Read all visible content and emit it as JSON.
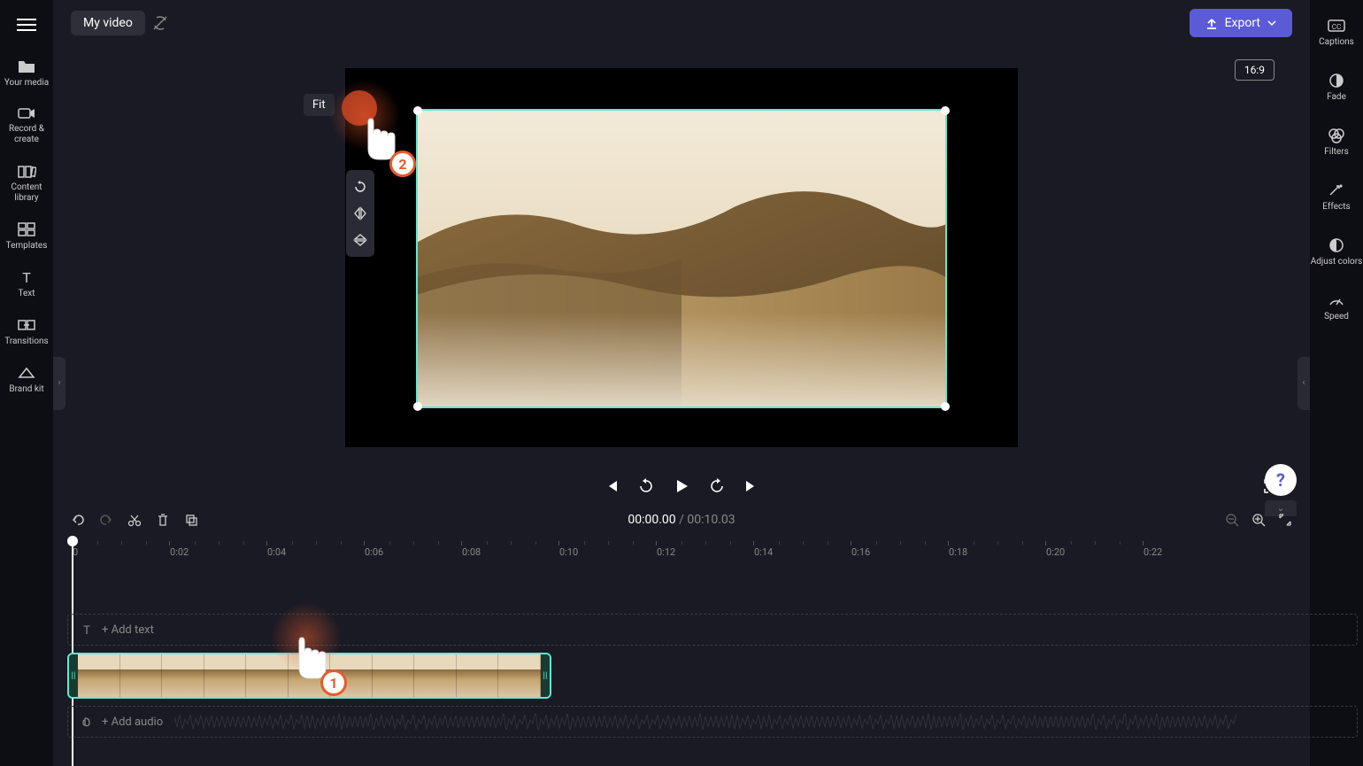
{
  "top": {
    "video_title": "My video",
    "export_label": "Export",
    "aspect_ratio": "16:9"
  },
  "left_sidebar": [
    {
      "key": "your-media",
      "label": "Your media"
    },
    {
      "key": "record-create",
      "label": "Record & create"
    },
    {
      "key": "content-library",
      "label": "Content library"
    },
    {
      "key": "templates",
      "label": "Templates"
    },
    {
      "key": "text",
      "label": "Text"
    },
    {
      "key": "transitions",
      "label": "Transitions"
    },
    {
      "key": "brand-kit",
      "label": "Brand kit"
    }
  ],
  "right_sidebar": [
    {
      "key": "captions",
      "label": "Captions"
    },
    {
      "key": "fade",
      "label": "Fade"
    },
    {
      "key": "filters",
      "label": "Filters"
    },
    {
      "key": "effects",
      "label": "Effects"
    },
    {
      "key": "adjust-colors",
      "label": "Adjust colors"
    },
    {
      "key": "speed",
      "label": "Speed"
    }
  ],
  "preview": {
    "fit_tooltip": "Fit"
  },
  "playback": {
    "current_time": "00:00.00",
    "duration": "00:10.03"
  },
  "ruler_ticks": [
    "0",
    "0:02",
    "0:04",
    "0:06",
    "0:08",
    "0:10",
    "0:12",
    "0:14",
    "0:16",
    "0:18",
    "0:20",
    "0:22"
  ],
  "tracks": {
    "add_text": "+ Add text",
    "add_audio": "+ Add audio"
  },
  "annotations": {
    "step1": "1",
    "step2": "2"
  }
}
